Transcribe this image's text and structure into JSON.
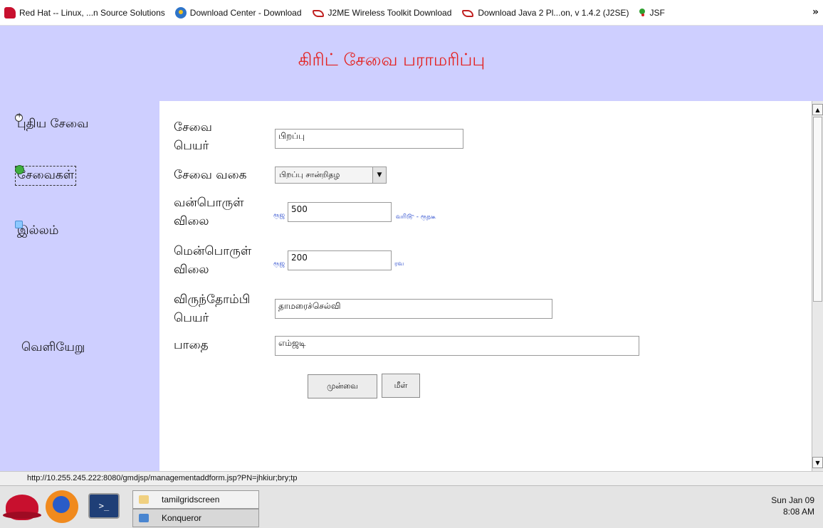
{
  "bookmarks": [
    {
      "label": "Red Hat -- Linux, ...n Source Solutions",
      "icon": "redhat-icon"
    },
    {
      "label": "Download Center - Download",
      "icon": "download-center-icon"
    },
    {
      "label": "J2ME Wireless Toolkit Download",
      "icon": "java-icon"
    },
    {
      "label": "Download Java 2 Pl...on, v 1.4.2 (J2SE)",
      "icon": "java-icon"
    },
    {
      "label": "JSF",
      "icon": "jsf-icon"
    }
  ],
  "more_label": "»",
  "page": {
    "title": "கிரிட் சேவை பராமரிப்பு",
    "nav": [
      {
        "label": "புதிய சேவை",
        "icon": "new-circle-icon"
      },
      {
        "label": "சேவைகள்",
        "icon": "green-bullet-icon"
      },
      {
        "label": "இல்லம்",
        "icon": "home-icon"
      },
      {
        "label": "வெளியேறு",
        "icon": ""
      }
    ]
  },
  "form": {
    "service_name_label": "சேவை பெயர்",
    "service_name_value": "பிறப்பு",
    "service_type_label": "சேவை வகை",
    "service_type_value": "பிறப்பு சான்றிதழ",
    "hardware_price_label": "வன்பொருள் விலை",
    "hardware_currency": "ரூஜ",
    "hardware_price_value": "500",
    "hardware_note": "வரி௹ - ரூநடீ",
    "software_price_label": "மென்பொருள் விலை",
    "software_currency": "ரூஜ",
    "software_price_value": "200",
    "software_note": "ரவ",
    "host_name_label": "விருந்தோம்பி பெயர்",
    "host_name_value": "தாமரைச்செல்வி",
    "path_label": "பாதை",
    "path_value": "எம்ஜடி",
    "submit_label": "முன்வை",
    "reset_label": "மீள்"
  },
  "status_url": "http://10.255.245.222:8080/gmdjsp/managementaddform.jsp?PN=jhkiur;bry;tp",
  "taskbar": {
    "tasks": [
      "tamilgridscreen",
      "Konqueror"
    ],
    "clock_date": "Sun Jan 09",
    "clock_time": "8:08 AM"
  },
  "colors": {
    "panel_bg": "#cecfff",
    "title_red": "#e4211f",
    "link_blue": "#2244cc"
  }
}
